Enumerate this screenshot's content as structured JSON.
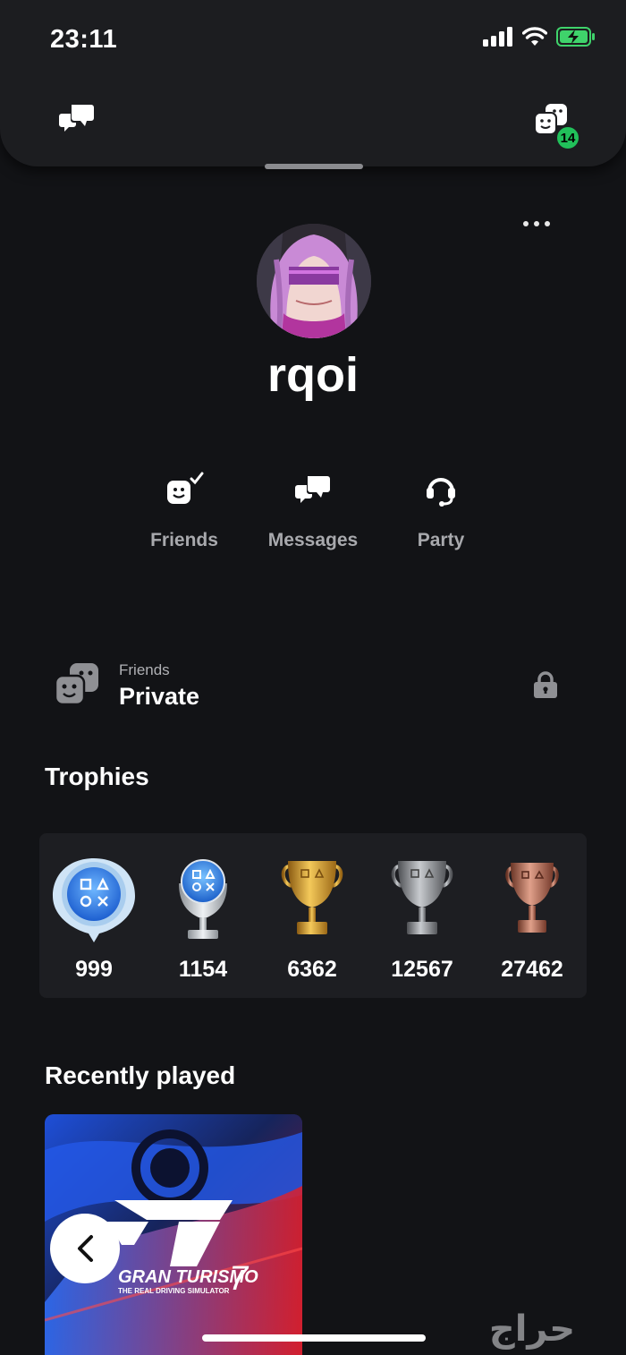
{
  "status_bar": {
    "time": "23:11"
  },
  "header": {
    "notification_count": "14"
  },
  "profile": {
    "username": "rqoi"
  },
  "actions": [
    {
      "label": "Friends",
      "icon": "friend-check-icon"
    },
    {
      "label": "Messages",
      "icon": "chat-bubbles-icon"
    },
    {
      "label": "Party",
      "icon": "headset-icon"
    }
  ],
  "friends_privacy": {
    "caption": "Friends",
    "value": "Private",
    "icon": "lock-icon"
  },
  "trophies": {
    "title": "Trophies",
    "items": [
      {
        "type": "level",
        "count": "999"
      },
      {
        "type": "platinum",
        "count": "1154"
      },
      {
        "type": "gold",
        "count": "6362"
      },
      {
        "type": "silver",
        "count": "12567"
      },
      {
        "type": "bronze",
        "count": "27462"
      }
    ]
  },
  "recently_played": {
    "title": "Recently played",
    "game": {
      "logo_text": "GRAN TURISMO",
      "logo_number": "7",
      "tagline": "THE REAL DRIVING SIMULATOR"
    }
  },
  "watermark": {
    "text": "حراج"
  },
  "colors": {
    "background": "#121316",
    "panel": "#1c1d20",
    "badge": "#21c05a",
    "gold": "#d9a53a",
    "silver": "#9a9b9f",
    "bronze": "#b36a55"
  }
}
